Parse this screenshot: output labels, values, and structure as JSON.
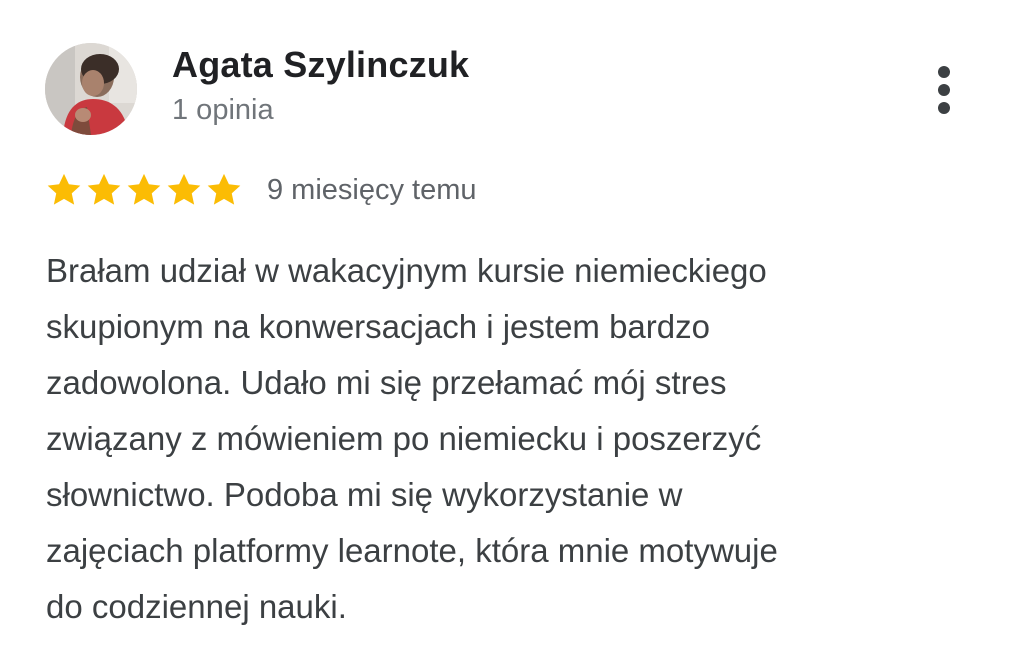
{
  "review": {
    "author": {
      "name": "Agata Szylinczuk",
      "meta": "1 opinia",
      "avatar_icon": "user-photo-avatar"
    },
    "more_icon": "more-vertical-icon",
    "rating": {
      "stars": 5,
      "max_stars": 5,
      "star_color": "#fbbc04",
      "date": "9 miesięcy temu"
    },
    "text_lines": [
      "Brałam udział w wakacyjnym kursie niemieckiego",
      "skupionym na konwersacjach i jestem bardzo",
      "zadowolona. Udało mi się przełamać mój stres",
      "związany z mówieniem po niemiecku i poszerzyć",
      "słownictwo. Podoba mi się wykorzystanie w",
      "zajęciach platformy learnote, która mnie motywuje",
      "do codziennej nauki."
    ]
  }
}
